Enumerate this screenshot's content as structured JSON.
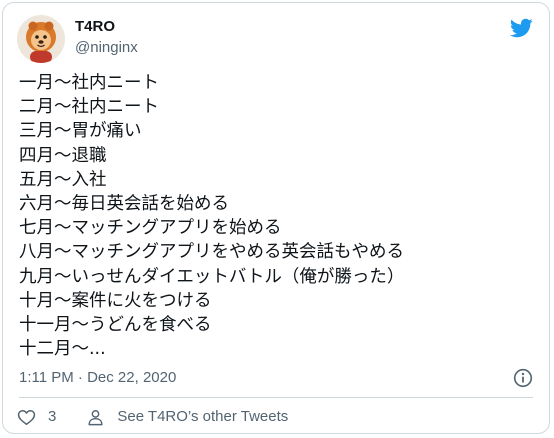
{
  "tweet": {
    "author": {
      "display_name": "T4RO",
      "handle": "@ninginx",
      "avatar_icon": "orange-lion-mascot-avatar"
    },
    "brand_icon": "twitter-bird-icon",
    "brand_color": "#1d9bf0",
    "text_lines": [
      "一月〜社内ニート",
      "二月〜社内ニート",
      "三月〜胃が痛い",
      "四月〜退職",
      "五月〜入社",
      "六月〜毎日英会話を始める",
      "七月〜マッチングアプリを始める",
      "八月〜マッチングアプリをやめる英会話もやめる",
      "九月〜いっせんダイエットバトル（俺が勝った）",
      "十月〜案件に火をつける",
      "十一月〜うどんを食べる",
      "十二月〜..."
    ],
    "timestamp": "1:11 PM · Dec 22, 2020",
    "info_icon": "info-icon",
    "actions": {
      "like_icon": "heart-icon",
      "like_count": "3",
      "profile_icon": "person-icon",
      "profile_label": "See T4RO’s other Tweets"
    }
  },
  "colors": {
    "text": "#0f1419",
    "secondary": "#536471",
    "border": "#cfd9de"
  }
}
